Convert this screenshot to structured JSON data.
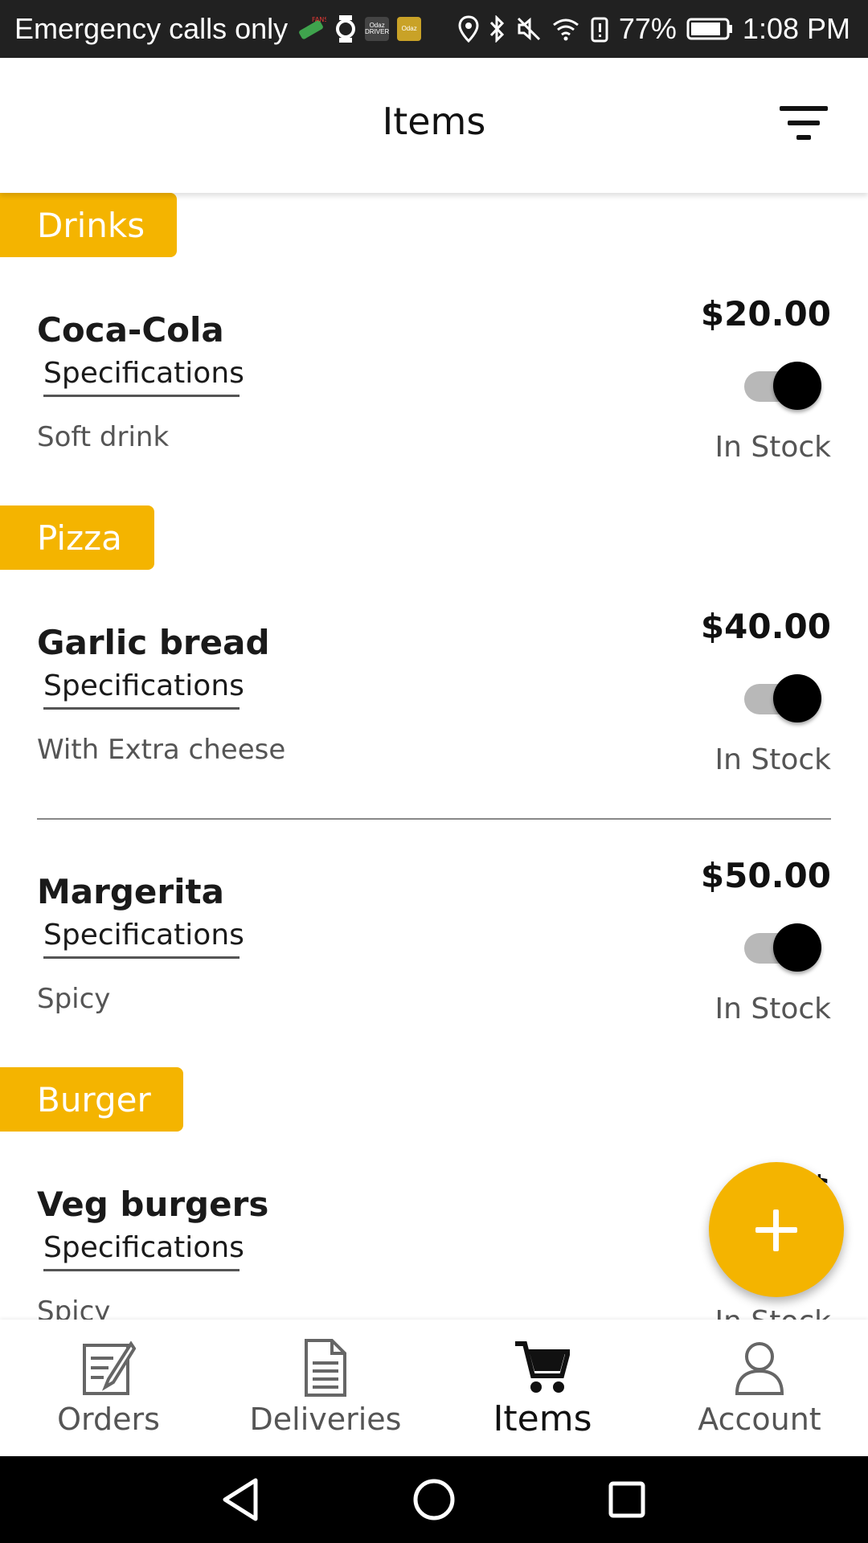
{
  "status_bar": {
    "carrier": "Emergency calls only",
    "app_badge_1": "Odaz DRIVER",
    "app_badge_2": "Odaz",
    "battery_percent": "77%",
    "time": "1:08 PM"
  },
  "header": {
    "title": "Items"
  },
  "categories": [
    {
      "name": "Drinks",
      "items": [
        {
          "name": "Coca-Cola",
          "spec_label": "Specifications",
          "description": "Soft drink",
          "price": "$20.00",
          "stock": "In Stock",
          "enabled": true
        }
      ]
    },
    {
      "name": "Pizza",
      "items": [
        {
          "name": "Garlic bread",
          "spec_label": "Specifications",
          "description": "With Extra cheese",
          "price": "$40.00",
          "stock": "In Stock",
          "enabled": true
        },
        {
          "name": "Margerita",
          "spec_label": "Specifications",
          "description": "Spicy",
          "price": "$50.00",
          "stock": "In Stock",
          "enabled": true
        }
      ]
    },
    {
      "name": "Burger",
      "items": [
        {
          "name": "Veg burgers",
          "spec_label": "Specifications",
          "description": "Spicy",
          "price": "$",
          "stock": "In Stock",
          "enabled": true
        }
      ]
    }
  ],
  "bottom_nav": {
    "orders": "Orders",
    "deliveries": "Deliveries",
    "items": "Items",
    "account": "Account",
    "active": "items"
  },
  "colors": {
    "accent": "#f4b400",
    "status_bar": "#212121",
    "system_nav": "#000000"
  },
  "icons": {
    "filter": "filter-icon",
    "fab": "plus-icon",
    "orders": "orders-icon",
    "deliveries": "document-icon",
    "items": "cart-icon",
    "account": "person-icon"
  }
}
